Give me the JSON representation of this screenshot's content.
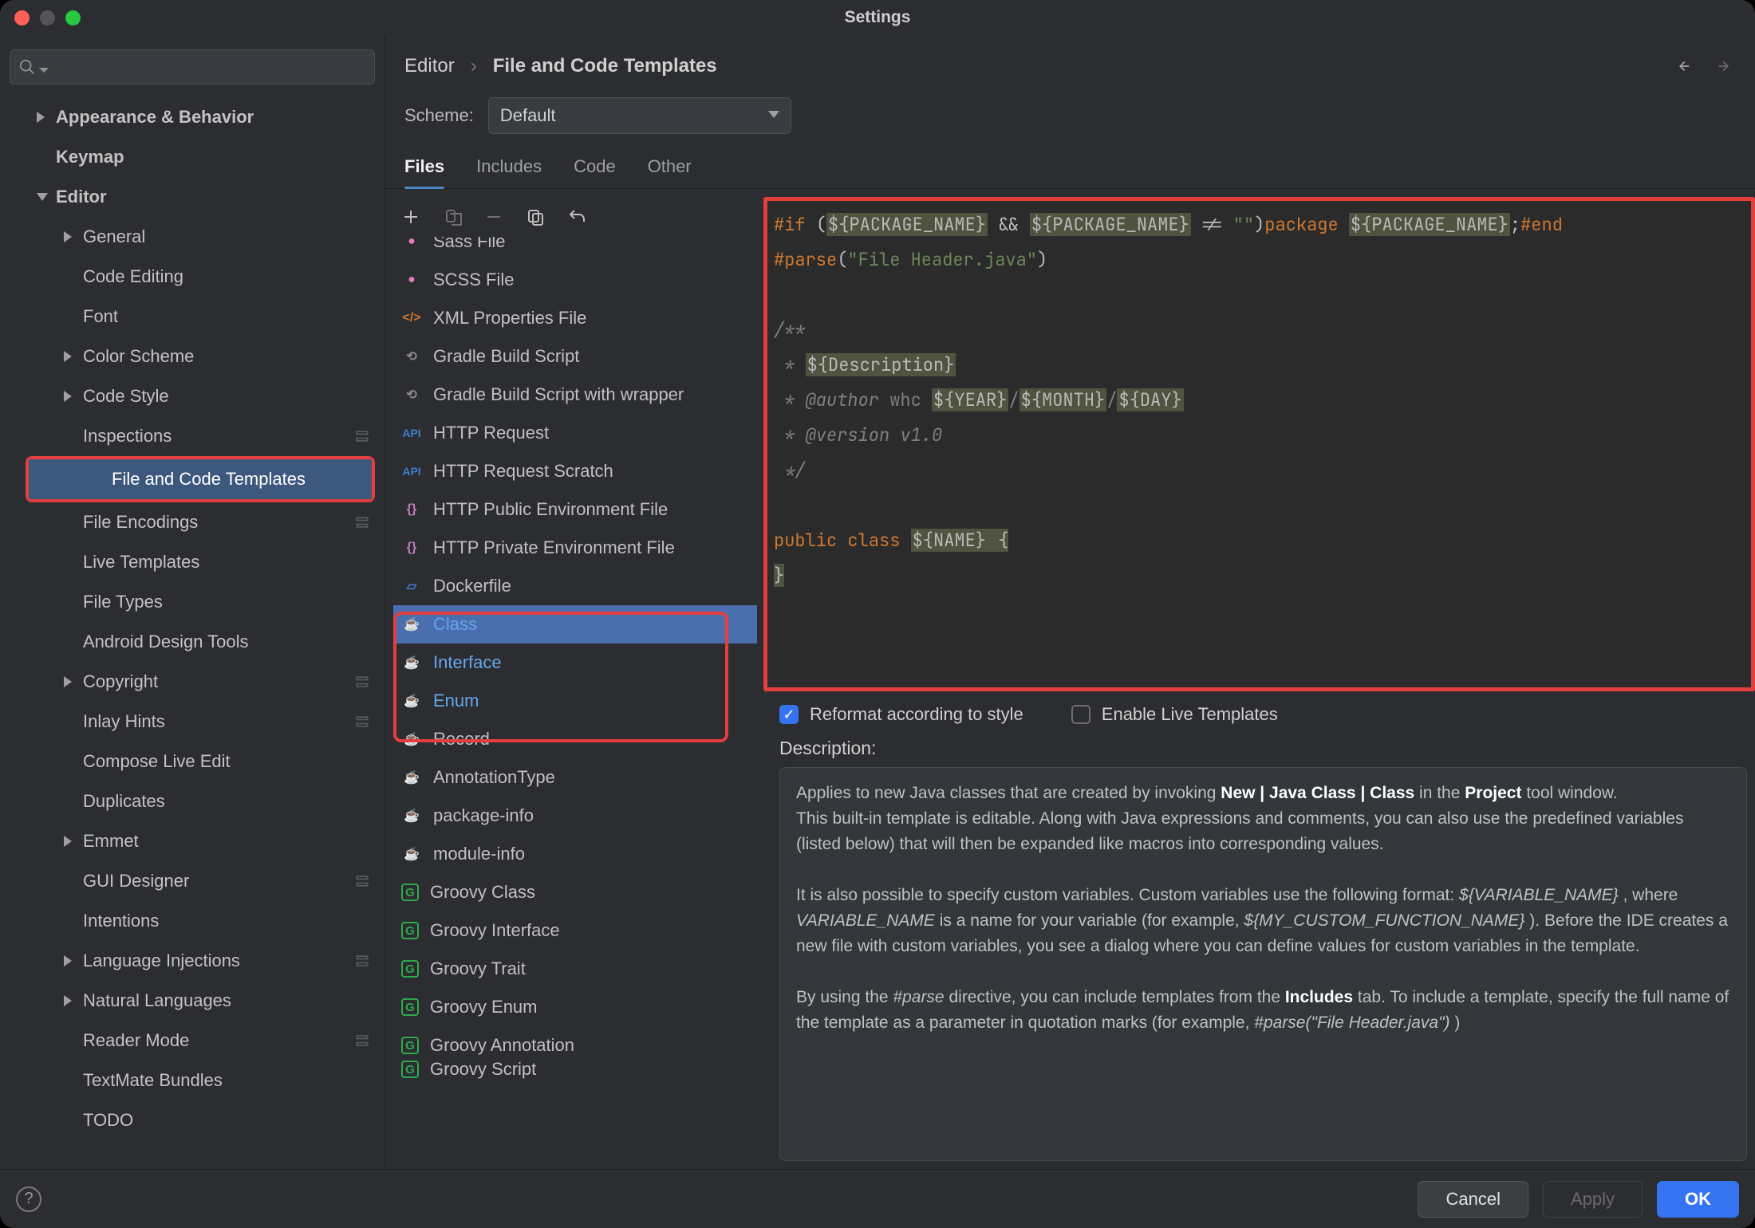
{
  "window": {
    "title": "Settings"
  },
  "search": {
    "placeholder": ""
  },
  "sidebar": {
    "items": [
      {
        "label": "Appearance & Behavior",
        "indent": 0,
        "arrow": "right",
        "bold": true
      },
      {
        "label": "Keymap",
        "indent": 0,
        "bold": true
      },
      {
        "label": "Editor",
        "indent": 0,
        "arrow": "down",
        "bold": true
      },
      {
        "label": "General",
        "indent": 1,
        "arrow": "right"
      },
      {
        "label": "Code Editing",
        "indent": 1
      },
      {
        "label": "Font",
        "indent": 1
      },
      {
        "label": "Color Scheme",
        "indent": 1,
        "arrow": "right"
      },
      {
        "label": "Code Style",
        "indent": 1,
        "arrow": "right"
      },
      {
        "label": "Inspections",
        "indent": 1,
        "gear": true
      },
      {
        "label": "File and Code Templates",
        "indent": 1,
        "selected": true,
        "highlight": true
      },
      {
        "label": "File Encodings",
        "indent": 1,
        "gear": true
      },
      {
        "label": "Live Templates",
        "indent": 1
      },
      {
        "label": "File Types",
        "indent": 1
      },
      {
        "label": "Android Design Tools",
        "indent": 1
      },
      {
        "label": "Copyright",
        "indent": 1,
        "arrow": "right",
        "gear": true
      },
      {
        "label": "Inlay Hints",
        "indent": 1,
        "gear": true
      },
      {
        "label": "Compose Live Edit",
        "indent": 1
      },
      {
        "label": "Duplicates",
        "indent": 1
      },
      {
        "label": "Emmet",
        "indent": 1,
        "arrow": "right"
      },
      {
        "label": "GUI Designer",
        "indent": 1,
        "gear": true
      },
      {
        "label": "Intentions",
        "indent": 1
      },
      {
        "label": "Language Injections",
        "indent": 1,
        "arrow": "right",
        "gear": true
      },
      {
        "label": "Natural Languages",
        "indent": 1,
        "arrow": "right"
      },
      {
        "label": "Reader Mode",
        "indent": 1,
        "gear": true
      },
      {
        "label": "TextMate Bundles",
        "indent": 1
      },
      {
        "label": "TODO",
        "indent": 1
      }
    ]
  },
  "breadcrumb": {
    "parent": "Editor",
    "current": "File and Code Templates"
  },
  "scheme": {
    "label": "Scheme:",
    "value": "Default"
  },
  "tabs": [
    {
      "label": "Files",
      "active": true
    },
    {
      "label": "Includes"
    },
    {
      "label": "Code"
    },
    {
      "label": "Other"
    }
  ],
  "toolbar": {
    "icons": [
      "plus-icon",
      "copy-file-icon",
      "minus-icon",
      "copy-icon",
      "undo-icon"
    ]
  },
  "files": [
    {
      "icon": "pink",
      "label": "Sass File",
      "cut": true
    },
    {
      "icon": "pink",
      "label": "SCSS File"
    },
    {
      "icon": "tag",
      "label": "XML Properties File"
    },
    {
      "icon": "gradle",
      "label": "Gradle Build Script"
    },
    {
      "icon": "gradle",
      "label": "Gradle Build Script with wrapper"
    },
    {
      "icon": "api",
      "label": "HTTP Request"
    },
    {
      "icon": "api",
      "label": "HTTP Request Scratch"
    },
    {
      "icon": "json",
      "label": "HTTP Public Environment File"
    },
    {
      "icon": "json",
      "label": "HTTP Private Environment File"
    },
    {
      "icon": "d",
      "label": "Dockerfile"
    },
    {
      "icon": "cup",
      "label": "Class",
      "selected": true,
      "mod": true
    },
    {
      "icon": "cup",
      "label": "Interface",
      "mod": true
    },
    {
      "icon": "cup",
      "label": "Enum",
      "mod": true
    },
    {
      "icon": "cup",
      "label": "Record"
    },
    {
      "icon": "cup",
      "label": "AnnotationType"
    },
    {
      "icon": "cup",
      "label": "package-info"
    },
    {
      "icon": "cup",
      "label": "module-info"
    },
    {
      "icon": "g",
      "label": "Groovy Class"
    },
    {
      "icon": "g",
      "label": "Groovy Interface"
    },
    {
      "icon": "g",
      "label": "Groovy Trait"
    },
    {
      "icon": "g",
      "label": "Groovy Enum"
    },
    {
      "icon": "g",
      "label": "Groovy Annotation"
    },
    {
      "icon": "g",
      "label": "Groovy Script",
      "cut": true
    }
  ],
  "editor": {
    "l1_if": "#if",
    "l1_v1": "${PACKAGE_NAME}",
    "l1_amp": " && ",
    "l1_v2": "${PACKAGE_NAME}",
    "l1_ne": " != ",
    "l1_q": "\"\"",
    "l1_pkg": "package ",
    "l1_v3": "${PACKAGE_NAME}",
    "l1_sc": ";",
    "l1_end": "#end",
    "l2_parse": "#parse",
    "l2_str": "\"File Header.java\"",
    "l4": "/**",
    "l5_s": " * ",
    "l5_v": "${Description}",
    "l6_s": " * @author ",
    "l6_w": "whc ",
    "l6_y": "${YEAR}",
    "l6_m": "${MONTH}",
    "l6_d": "${DAY}",
    "l6_sl": "/",
    "l7": " * @version v1.0",
    "l8": " */",
    "l10_pub": "public ",
    "l10_cls": "class ",
    "l10_v": "${NAME}",
    "l10_br": " {",
    "l11": "}"
  },
  "opts": {
    "reformat": "Reformat according to style",
    "enable": "Enable Live Templates"
  },
  "desc": {
    "h": "Description:",
    "p1a": "Applies to new Java classes that are created by invoking ",
    "p1b": "New | Java Class | Class",
    "p1c": " in the ",
    "p1d": "Project",
    "p1e": " tool window.",
    "p2": "This built-in template is editable. Along with Java expressions and comments, you can also use the predefined variables (listed below) that will then be expanded like macros into corresponding values.",
    "p3a": "It is also possible to specify custom variables. Custom variables use the following format: ",
    "p3b": "${VARIABLE_NAME}",
    "p3c": ", where ",
    "p3d": "VARIABLE_NAME",
    "p3e": " is a name for your variable (for example, ",
    "p3f": "${MY_CUSTOM_FUNCTION_NAME}",
    "p3g": "). Before the IDE creates a new file with custom variables, you see a dialog where you can define values for custom variables in the template.",
    "p4a": "By using the ",
    "p4b": "#parse",
    "p4c": " directive, you can include templates from the ",
    "p4d": "Includes",
    "p4e": " tab. To include a template, specify the full name of the template as a parameter in quotation marks (for example, ",
    "p4f": "#parse(\"File Header.java\")",
    "p4g": ")"
  },
  "footer": {
    "cancel": "Cancel",
    "apply": "Apply",
    "ok": "OK"
  }
}
